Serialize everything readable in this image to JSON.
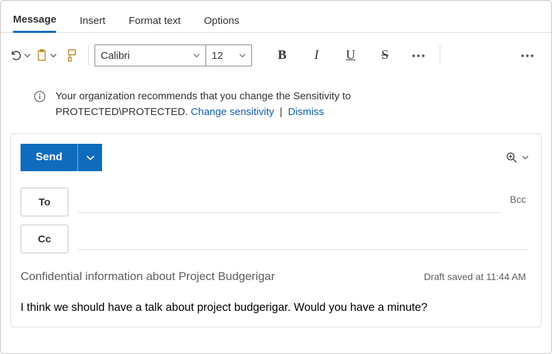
{
  "tabs": {
    "message": "Message",
    "insert": "Insert",
    "format": "Format text",
    "options": "Options"
  },
  "toolbar": {
    "font_name": "Calibri",
    "font_size": "12"
  },
  "policy": {
    "line1": "Your organization recommends that you change the Sensitivity to",
    "line2": "PROTECTED\\PROTECTED. ",
    "change": "Change sensitivity",
    "dismiss": "Dismiss"
  },
  "compose": {
    "send": "Send",
    "to": "To",
    "cc": "Cc",
    "bcc": "Bcc",
    "subject": "Confidential information about Project Budgerigar",
    "draft": "Draft saved at 11:44 AM",
    "body": "I think we should have a talk about project budgerigar. Would you have a minute?"
  }
}
